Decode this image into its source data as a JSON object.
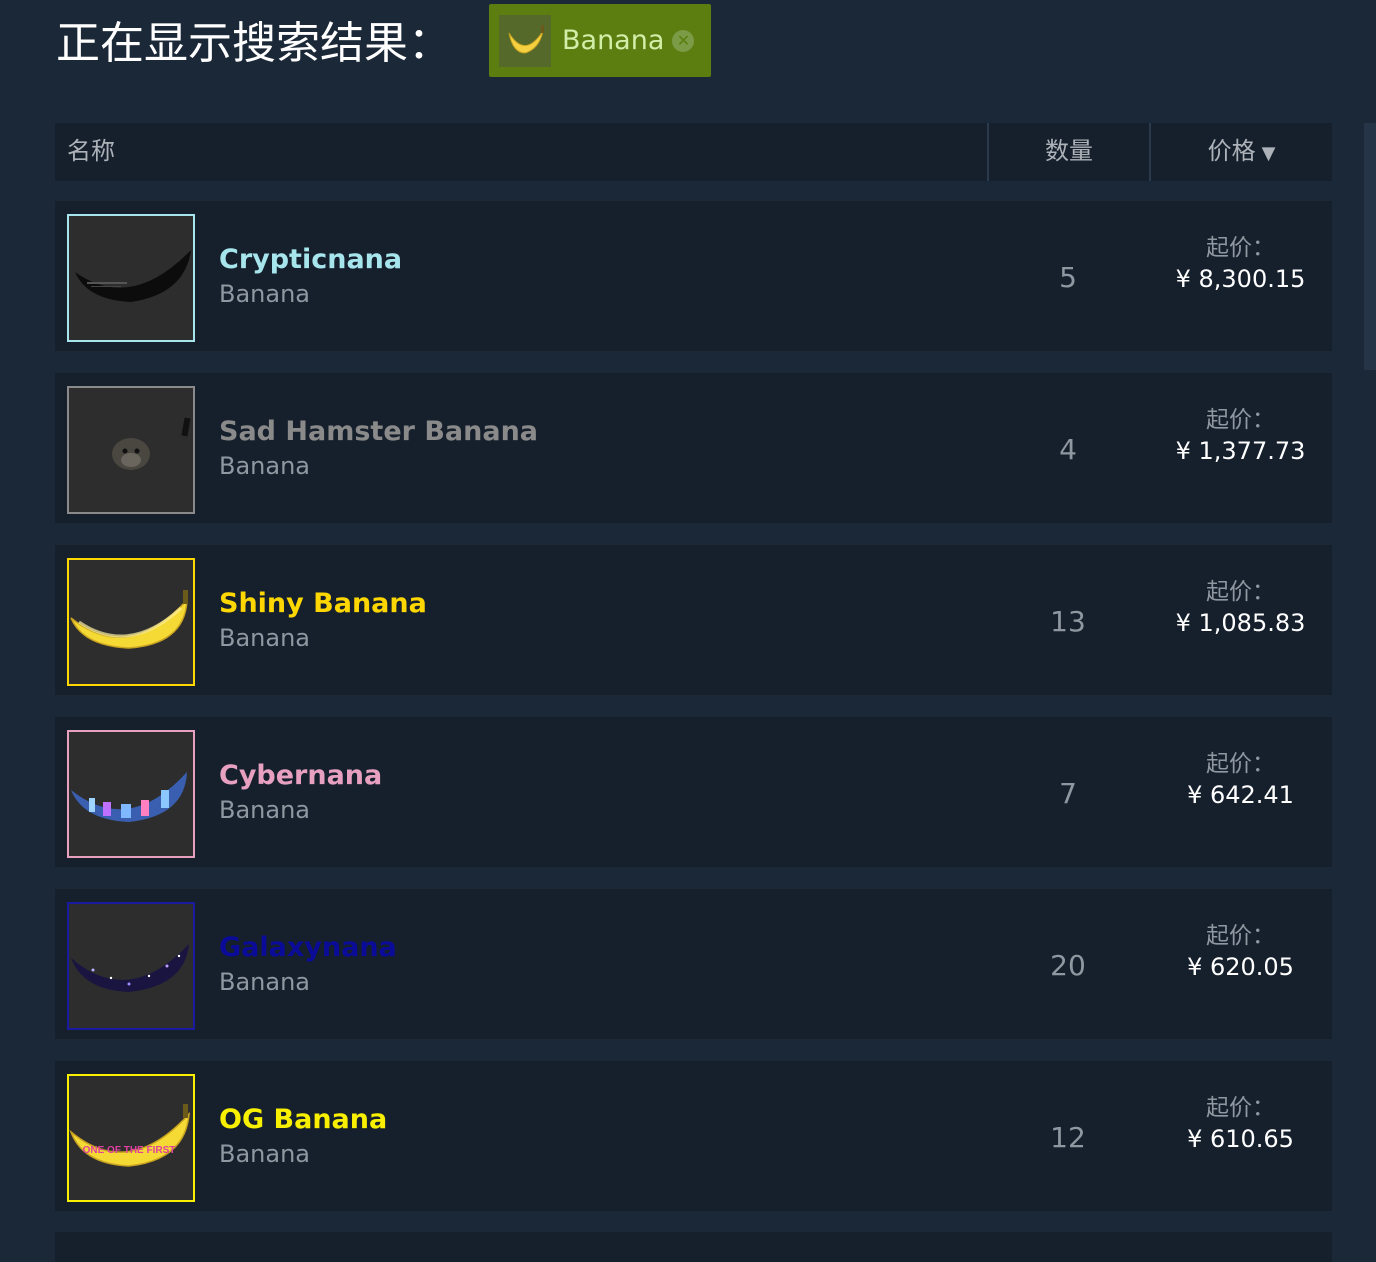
{
  "header": {
    "title": "正在显示搜索结果：",
    "filter_tag": {
      "label": "Banana",
      "thumb_icon": "banana-icon",
      "remove_icon": "close-circle-icon"
    }
  },
  "table": {
    "columns": {
      "name": "名称",
      "quantity": "数量",
      "price": "价格",
      "price_sort_icon": "sort-desc-triangle-icon"
    },
    "rows": [
      {
        "name": "Crypticnana",
        "game": "Banana",
        "quantity": "5",
        "price_label": "起价：",
        "price": "¥ 8,300.15",
        "name_color": "#a6e5ec",
        "border_color": "#a6e5ec",
        "icon": "black-banana-icon"
      },
      {
        "name": "Sad Hamster Banana",
        "game": "Banana",
        "quantity": "4",
        "price_label": "起价：",
        "price": "¥ 1,377.73",
        "name_color": "#8a8a8a",
        "border_color": "#8a8a8a",
        "icon": "hamster-icon"
      },
      {
        "name": "Shiny Banana",
        "game": "Banana",
        "quantity": "13",
        "price_label": "起价：",
        "price": "¥ 1,085.83",
        "name_color": "#ffd700",
        "border_color": "#ffd700",
        "icon": "yellow-banana-icon"
      },
      {
        "name": "Cybernana",
        "game": "Banana",
        "quantity": "7",
        "price_label": "起价：",
        "price": "¥ 642.41",
        "name_color": "#e7a0c0",
        "border_color": "#e7a0c0",
        "icon": "cyber-banana-icon"
      },
      {
        "name": "Galaxynana",
        "game": "Banana",
        "quantity": "20",
        "price_label": "起价：",
        "price": "¥ 620.05",
        "name_color": "#0b0b9a",
        "border_color": "#1a1aa0",
        "icon": "galaxy-banana-icon"
      },
      {
        "name": "OG Banana",
        "game": "Banana",
        "quantity": "12",
        "price_label": "起价：",
        "price": "¥ 610.65",
        "name_color": "#f8f000",
        "border_color": "#f8f000",
        "icon": "og-banana-icon",
        "icon_text": "ONE OF THE FIRST"
      }
    ]
  },
  "colors": {
    "background": "#1b2838",
    "row_background": "#16202d",
    "filter_tag_background": "#5c7e10",
    "muted_text": "#8f98a0"
  }
}
